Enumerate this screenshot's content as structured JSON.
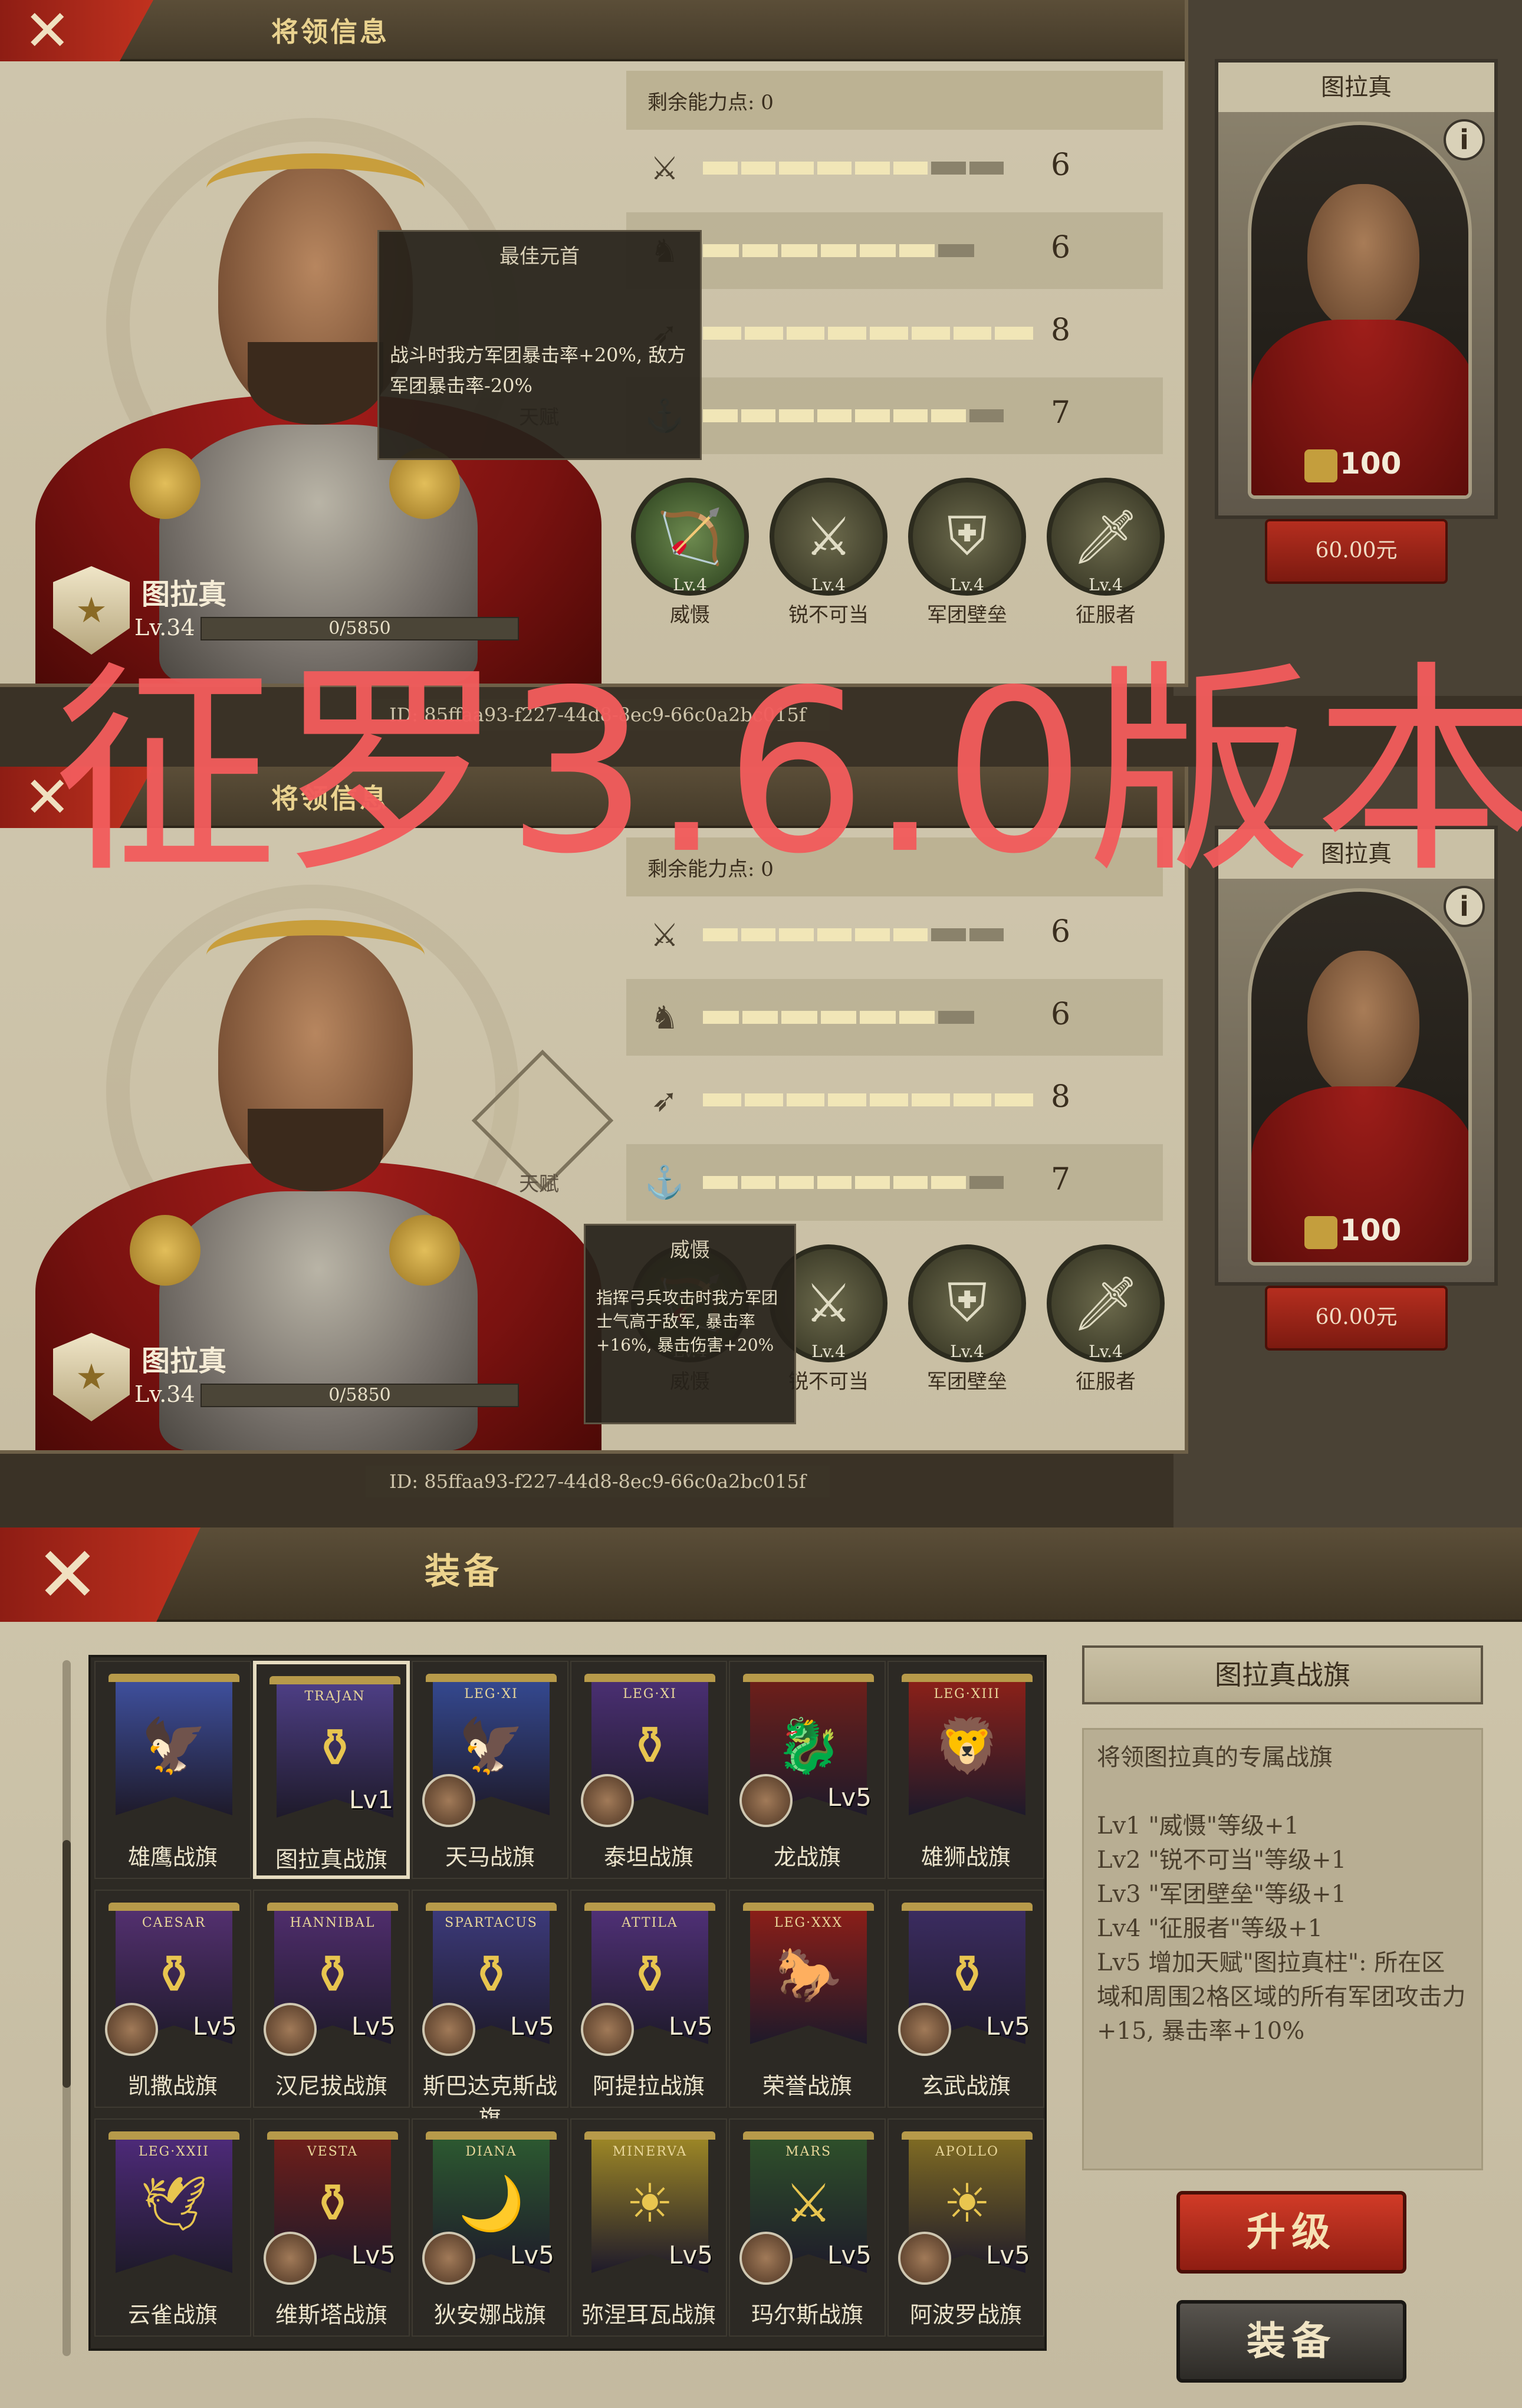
{
  "panel_title": "将领信息",
  "hero": {
    "name": "图拉真",
    "level": "Lv.34",
    "exp": "0/5850",
    "exp_fraction": 0
  },
  "stats": {
    "remaining_label": "剩余能力点: 0",
    "rows": [
      {
        "icon": "sword-icon",
        "value": "6",
        "fill": 0.86
      },
      {
        "icon": "horse-icon",
        "value": "6",
        "fill": 0.86
      },
      {
        "icon": "bow-icon",
        "value": "8",
        "fill": 1.0
      },
      {
        "icon": "anchor-icon",
        "value": "7",
        "fill": 0.93
      }
    ]
  },
  "talent_label": "天赋",
  "skills": [
    {
      "level": "Lv.4",
      "name": "威慑"
    },
    {
      "level": "Lv.4",
      "name": "锐不可当"
    },
    {
      "level": "Lv.4",
      "name": "军团壁垒"
    },
    {
      "level": "Lv.4",
      "name": "征服者"
    }
  ],
  "tooltip1": {
    "title": "最佳元首",
    "body": "战斗时我方军团暴击率+20%, 敌方军团暴击率-20%"
  },
  "tooltip2": {
    "title": "威慑",
    "body": "指挥弓兵攻击时我方军团士气高于敌军, 暴击率+16%, 暴击伤害+20%"
  },
  "side_card": {
    "title": "图拉真",
    "info": "i",
    "power": "100",
    "price": "60.00元"
  },
  "watermark": "征罗3.6.0版本",
  "id_text": "ID: 85ffaa93-f227-44d8-8ec9-66c0a2bc015f",
  "id_text_partial": "ID: 85ffaa93-f227-44d8-8ec9-66c0a2bc015f",
  "equip": {
    "title": "装备",
    "items": [
      {
        "name": "雄鹰战旗",
        "lv": "",
        "color": "#3e4f9c",
        "legion": "",
        "avatar": false
      },
      {
        "name": "图拉真战旗",
        "lv": "Lv1",
        "color": "#4d3e84",
        "legion": "TRAJAN",
        "avatar": false,
        "selected": true
      },
      {
        "name": "天马战旗",
        "lv": "",
        "color": "#34488f",
        "legion": "LEG·XI",
        "avatar": true
      },
      {
        "name": "泰坦战旗",
        "lv": "",
        "color": "#4a2f72",
        "legion": "LEG·XI",
        "avatar": true
      },
      {
        "name": "龙战旗",
        "lv": "Lv5",
        "color": "#6d1f1a",
        "legion": "",
        "avatar": true
      },
      {
        "name": "雄狮战旗",
        "lv": "",
        "color": "#8a2019",
        "legion": "LEG·XIII",
        "avatar": false
      },
      {
        "name": "凯撒战旗",
        "lv": "Lv5",
        "color": "#53306f",
        "legion": "CAESAR",
        "avatar": true
      },
      {
        "name": "汉尼拔战旗",
        "lv": "Lv5",
        "color": "#4f2d6c",
        "legion": "HANNIBAL",
        "avatar": true
      },
      {
        "name": "斯巴达克斯战旗",
        "lv": "Lv5",
        "color": "#3c3a7a",
        "legion": "SPARTACUS",
        "avatar": true
      },
      {
        "name": "阿提拉战旗",
        "lv": "Lv5",
        "color": "#4f3076",
        "legion": "ATTILA",
        "avatar": true
      },
      {
        "name": "荣誉战旗",
        "lv": "",
        "color": "#8a1e18",
        "legion": "LEG·XXX",
        "avatar": false
      },
      {
        "name": "玄武战旗",
        "lv": "Lv5",
        "color": "#3b2c60",
        "legion": "",
        "avatar": true
      },
      {
        "name": "云雀战旗",
        "lv": "",
        "color": "#4d2a78",
        "legion": "LEG·XXII",
        "avatar": false
      },
      {
        "name": "维斯塔战旗",
        "lv": "Lv5",
        "color": "#6d1e1a",
        "legion": "VESTA",
        "avatar": true
      },
      {
        "name": "狄安娜战旗",
        "lv": "Lv5",
        "color": "#2c5830",
        "legion": "DIANA",
        "avatar": true
      },
      {
        "name": "弥涅耳瓦战旗",
        "lv": "Lv5",
        "color": "#9b8526",
        "legion": "MINERVA",
        "avatar": false
      },
      {
        "name": "玛尔斯战旗",
        "lv": "Lv5",
        "color": "#2e4f2a",
        "legion": "MARS",
        "avatar": true
      },
      {
        "name": "阿波罗战旗",
        "lv": "Lv5",
        "color": "#7e6a23",
        "legion": "APOLLO",
        "avatar": true
      }
    ],
    "info": {
      "title": "图拉真战旗",
      "desc": "将领图拉真的专属战旗",
      "lines": [
        "Lv1 \"威慑\"等级+1",
        "Lv2 \"锐不可当\"等级+1",
        "Lv3 \"军团壁垒\"等级+1",
        "Lv4 \"征服者\"等级+1",
        "Lv5 增加天赋\"图拉真柱\": 所在区域和周围2格区域的所有军团攻击力+15, 暴击率+10%"
      ]
    },
    "upgrade_label": "升级",
    "equip_label": "装备"
  }
}
